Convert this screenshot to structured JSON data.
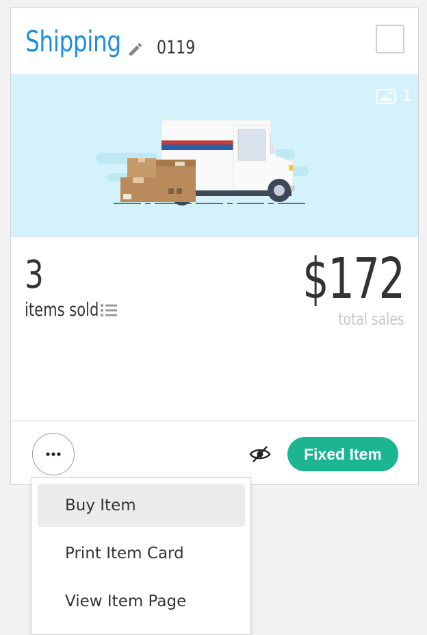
{
  "card": {
    "title": "Shipping",
    "item_number": "0119",
    "image_count": "1",
    "items_sold_count": "3",
    "items_sold_label": "items sold",
    "total_sales_value": "$172",
    "total_sales_label": "total sales",
    "status_badge": "Fixed Item",
    "colors": {
      "title": "#1a8fe3",
      "badge": "#1bb592",
      "image_background": "#d3f2fb"
    },
    "icons": [
      "pencil-icon",
      "photo-icon",
      "truck-illustration",
      "list-icon",
      "more-dots-icon",
      "eye-slash-icon"
    ]
  },
  "menu": {
    "items": [
      {
        "label": "Buy Item",
        "highlighted": true
      },
      {
        "label": "Print Item Card",
        "highlighted": false
      },
      {
        "label": "View Item Page",
        "highlighted": false
      }
    ]
  }
}
